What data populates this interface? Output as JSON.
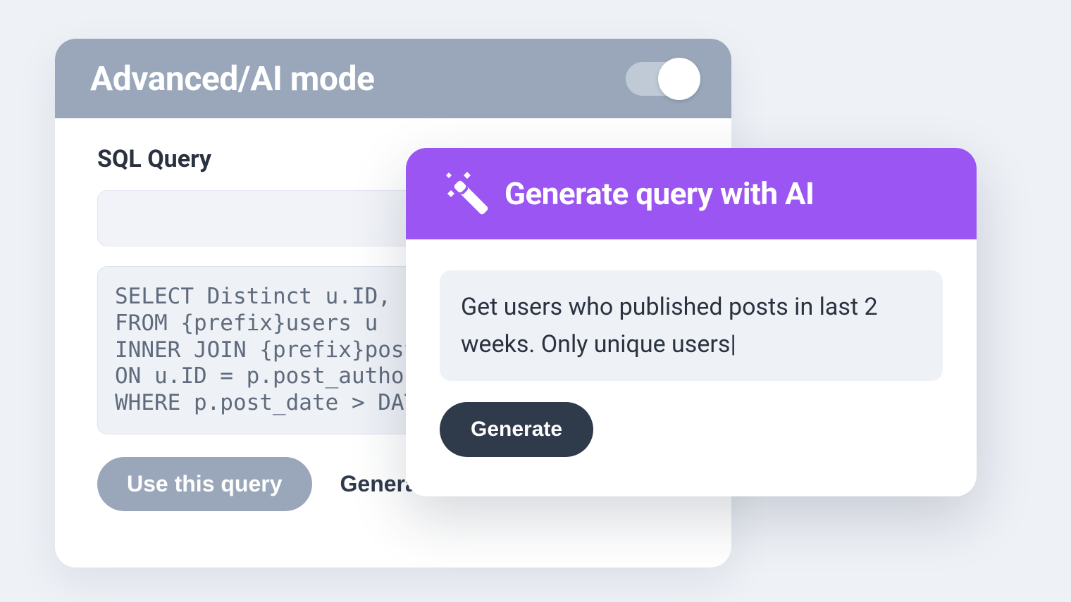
{
  "back_card": {
    "title": "Advanced/AI mode",
    "toggle_on": true,
    "section_label": "SQL Query",
    "input_value": "",
    "sql_code": "SELECT Distinct u.ID, u.user_login\nFROM {prefix}users u\nINNER JOIN {prefix}posts p\nON u.ID = p.post_author\nWHERE p.post_date > DATE_SUB(N",
    "use_button": "Use this query",
    "generate_new_button": "Generate n"
  },
  "front_card": {
    "title": "Generate query with AI",
    "prompt_text": "Get users who published posts in last 2 weeks. Only unique users",
    "generate_button": "Generate"
  },
  "colors": {
    "muted_blue": "#9aa7bb",
    "purple": "#9a55f2",
    "dark": "#2f3a4a"
  }
}
